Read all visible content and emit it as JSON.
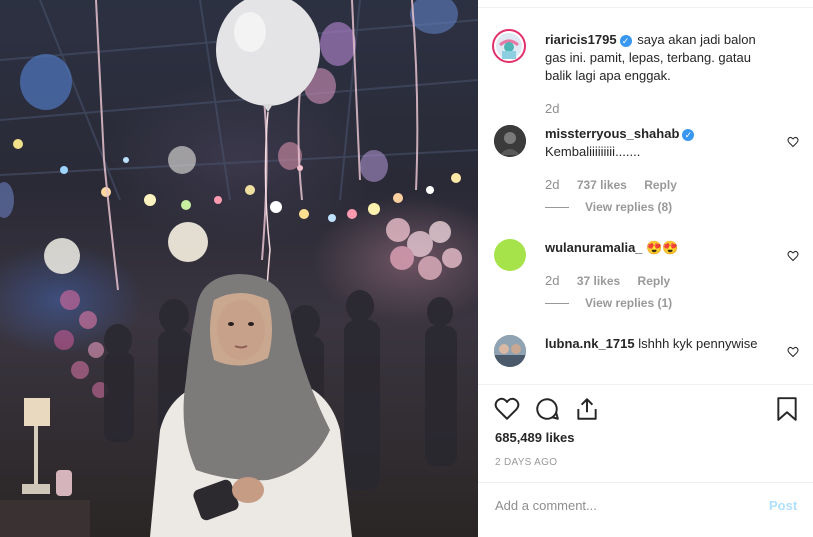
{
  "caption": {
    "username": "riaricis1795",
    "text": "saya akan jadi balon gas ini. pamit, lepas, terbang. gatau balik lagi apa enggak.",
    "time": "2d"
  },
  "comments": [
    {
      "username": "missterryous_shahab",
      "text": "Kembaliiiiiiiii.......",
      "time": "2d",
      "likes": "737 likes",
      "reply": "Reply",
      "view_replies": "View replies (8)"
    },
    {
      "username": "wulanuramalia_",
      "text": "😍😍",
      "time": "2d",
      "likes": "37 likes",
      "reply": "Reply",
      "view_replies": "View replies (1)"
    },
    {
      "username": "lubna.nk_1715",
      "text": "lshhh kyk pennywise"
    }
  ],
  "post": {
    "likes": "685,489 likes",
    "time_ago": "2 DAYS AGO"
  },
  "composer": {
    "placeholder": "Add a comment...",
    "post_label": "Post"
  },
  "colors": {
    "verified": "#3897f0",
    "avatar_wulan": "#a6e34a",
    "post_disabled": "#b2dffc"
  }
}
